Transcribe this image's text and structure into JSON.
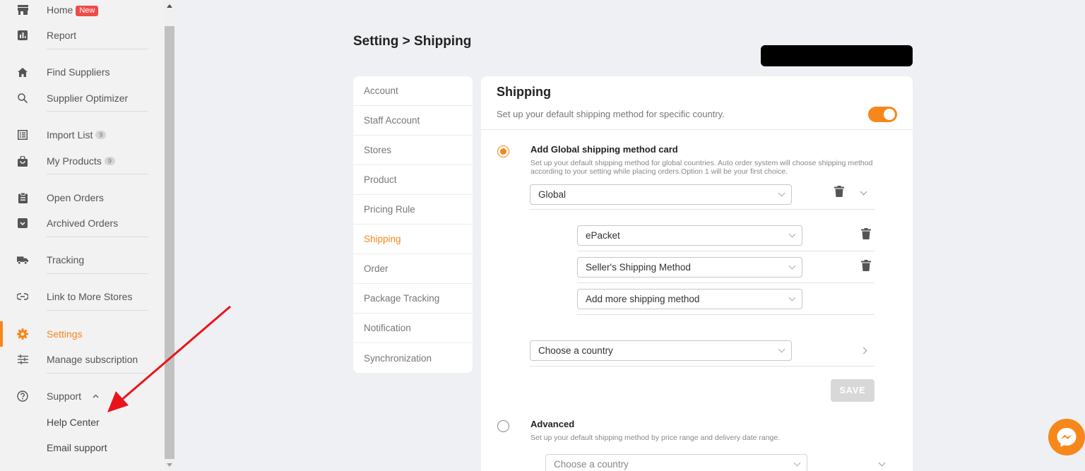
{
  "sidebar": {
    "items": [
      {
        "label": "Home",
        "badge": "New",
        "icon": "store-icon"
      },
      {
        "label": "Report",
        "icon": "bar-chart-icon"
      },
      {
        "label": "Find Suppliers",
        "icon": "home-icon"
      },
      {
        "label": "Supplier Optimizer",
        "icon": "search-icon"
      },
      {
        "label": "Import List",
        "count": "9",
        "icon": "list-icon"
      },
      {
        "label": "My Products",
        "count": "9",
        "icon": "shopping-bag-icon"
      },
      {
        "label": "Open Orders",
        "icon": "clipboard-icon"
      },
      {
        "label": "Archived Orders",
        "icon": "archive-icon"
      },
      {
        "label": "Tracking",
        "icon": "truck-icon"
      },
      {
        "label": "Link to More Stores",
        "icon": "link-icon"
      },
      {
        "label": "Settings",
        "icon": "gear-icon",
        "active": true
      },
      {
        "label": "Manage subscription",
        "icon": "sliders-icon"
      },
      {
        "label": "Support",
        "icon": "help-circle-icon"
      }
    ],
    "support_sub": [
      "Help Center",
      "Email support"
    ]
  },
  "header": {
    "breadcrumb": "Setting > Shipping"
  },
  "settings_menu": {
    "items": [
      "Account",
      "Staff Account",
      "Stores",
      "Product",
      "Pricing Rule",
      "Shipping",
      "Order",
      "Package Tracking",
      "Notification",
      "Synchronization"
    ],
    "active": "Shipping"
  },
  "shipping": {
    "title": "Shipping",
    "description": "Set up your default shipping method for specific country.",
    "toggle_on": true,
    "global_card": {
      "title": "Add Global shipping method card",
      "description": "Set up your default shipping method for global countries. Auto order system will choose shipping method according to your setting while placing orders.Option 1 will be your first choice.",
      "region_select": "Global",
      "methods": [
        "ePacket",
        "Seller's Shipping Method"
      ],
      "add_method_placeholder": "Add more shipping method",
      "country_select": "Choose a country",
      "save_label": "SAVE"
    },
    "advanced": {
      "title": "Advanced",
      "description": "Set up your default shipping method by price range and delivery date range.",
      "country_select": "Choose a country"
    }
  },
  "colors": {
    "accent": "#f7871a",
    "badge_red": "#f04a4a",
    "annotation_red": "#e8141c"
  }
}
